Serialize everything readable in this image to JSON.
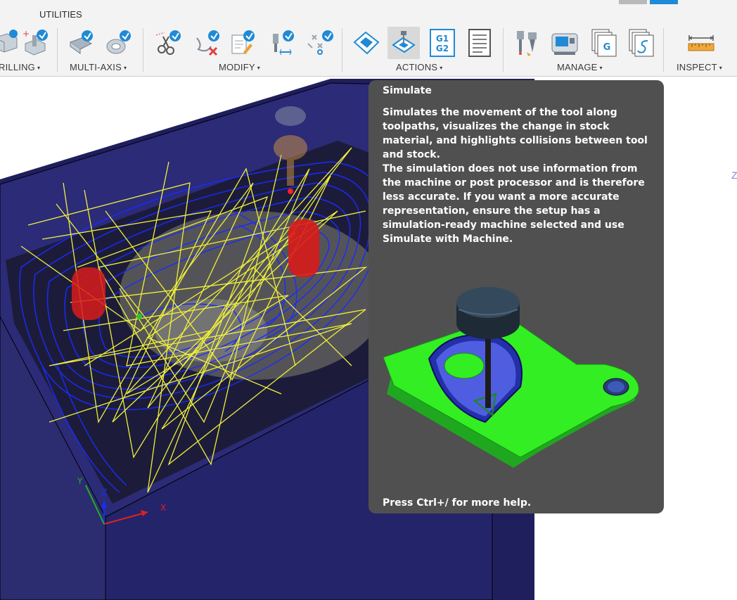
{
  "toolbar": {
    "tab_label": "UTILITIES",
    "groups": [
      {
        "label": "RILLING",
        "arrow": "▾"
      },
      {
        "label": "MULTI-AXIS",
        "arrow": "▾"
      },
      {
        "label": "MODIFY",
        "arrow": "▾"
      },
      {
        "label": "ACTIONS",
        "arrow": "▾"
      },
      {
        "label": "MANAGE",
        "arrow": "▾"
      },
      {
        "label": "INSPECT",
        "arrow": "▾"
      }
    ],
    "icons": {
      "drilling": [
        "drill-hole-icon",
        "drill-add-icon"
      ],
      "multi_axis": [
        "multi-axis-swarf-icon",
        "multi-axis-flow-icon"
      ],
      "modify": [
        "scissors-trim-icon",
        "delete-path-icon",
        "edit-notes-icon",
        "tool-length-icon",
        "pattern-icon"
      ],
      "actions": [
        "setup-box-icon",
        "simulate-icon",
        "post-process-icon",
        "setup-sheet-icon"
      ],
      "manage": [
        "tool-library-icon",
        "machine-library-icon",
        "template-g-icon",
        "template-s-icon"
      ],
      "inspect": [
        "measure-ruler-icon"
      ]
    },
    "post_process_text": {
      "line1": "G1",
      "line2": "G2"
    },
    "template_letters": {
      "g": "G"
    },
    "accent_color": "#1f8ad6"
  },
  "tooltip": {
    "title": "Simulate",
    "paragraph1": "Simulates the movement of the tool along toolpaths, visualizes the change in stock material, and highlights collisions between tool and stock.",
    "paragraph2": "The simulation does not use information from the machine or post processor and is therefore less accurate. If you want a more accurate representation, ensure the setup has a simulation-ready machine selected and use Simulate with Machine.",
    "footer": "Press Ctrl+/ for more help.",
    "image_icon": "simulated-part-illustration-icon"
  },
  "viewport": {
    "axes": {
      "x": "X",
      "y": "Y",
      "z": "Z"
    },
    "colors": {
      "stock": "#1f1f5e",
      "toolpath": "#1a2bff",
      "rapid": "#f0f03a",
      "collision": "#d81b1b",
      "part": "#777777"
    }
  }
}
